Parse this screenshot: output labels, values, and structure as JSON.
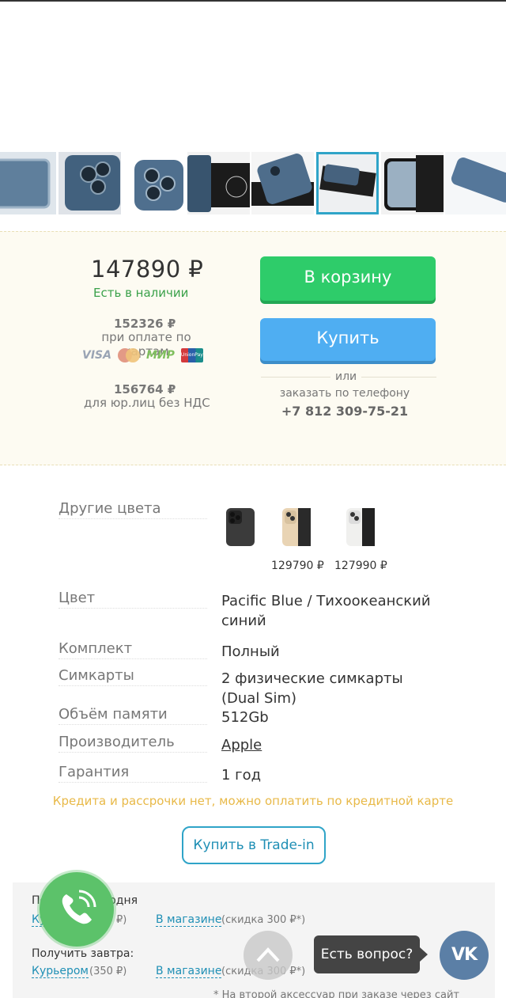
{
  "thumbnails": [
    {
      "name": "thumb-1"
    },
    {
      "name": "thumb-2"
    },
    {
      "name": "thumb-3"
    },
    {
      "name": "thumb-4"
    },
    {
      "name": "thumb-5"
    },
    {
      "name": "thumb-6",
      "active": true
    },
    {
      "name": "thumb-7"
    },
    {
      "name": "thumb-8"
    }
  ],
  "buy": {
    "price": "147890 ₽",
    "stock": "Есть в наличии",
    "card_price": "152326 ₽",
    "card_label": "при оплате по картам",
    "card_logos": [
      "VISA",
      "MasterCard",
      "МИР",
      "UnionPay"
    ],
    "jur_price": "156764 ₽",
    "jur_label": "для юр.лиц без НДС",
    "cart_label": "В корзину",
    "buy_label": "Купить",
    "or": "или",
    "phone_label": "заказать по телефону",
    "phone": "+7 812 309-75-21"
  },
  "props": {
    "other_colors_label": "Другие цвета",
    "other_colors": [
      {
        "color": "#3b3b3b",
        "price": ""
      },
      {
        "color": "#e9d4b4",
        "price": "129790 ₽"
      },
      {
        "color": "#f0f0ee",
        "price": "127990 ₽"
      }
    ],
    "color_label": "Цвет",
    "color_value": "Pacific Blue / Тихоокеанский синий",
    "kit_label": "Комплект",
    "kit_value": "Полный",
    "sim_label": "Симкарты",
    "sim_value": "2 физические симкарты (Dual Sim)",
    "memory_label": "Объём памяти",
    "memory_value": "512Gb",
    "maker_label": "Производитель",
    "maker_value": "Apple",
    "warranty_label": "Гарантия",
    "warranty_value": "1 год"
  },
  "credit_note": "Кредита и рассрочки нет, можно оплатить по кредитной карте",
  "trade_in_label": "Купить в Trade-in",
  "delivery": {
    "today_title": "Получить сегодня",
    "today_courier": "Курьером",
    "today_courier_price": "(350 ₽)",
    "today_store": "В магазине",
    "today_store_note": "(скидка 300 ₽*)",
    "tomorrow_title": "Получить завтра:",
    "tomorrow_courier": "Курьером",
    "tomorrow_courier_price": "(350 ₽)",
    "tomorrow_store": "В магазине",
    "tomorrow_store_note": "(скидка 300 ₽*)",
    "footnote": "* На второй аксессуар при заказе через сайт"
  },
  "widgets": {
    "question": "Есть вопрос?",
    "vk": "VK"
  },
  "colors": {
    "accent": "#2fa4c8",
    "green_button": "#2ecc6a",
    "blue_button": "#4faef2",
    "stock_green": "#3aa14a",
    "credit_yellow": "#e8b948"
  }
}
